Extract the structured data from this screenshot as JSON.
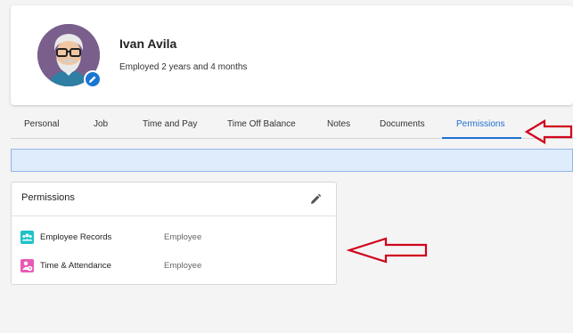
{
  "employee": {
    "name": "Ivan Avila",
    "tenure": "Employed 2 years and 4 months"
  },
  "tabs": [
    {
      "label": "Personal"
    },
    {
      "label": "Job"
    },
    {
      "label": "Time and Pay"
    },
    {
      "label": "Time Off Balance"
    },
    {
      "label": "Notes"
    },
    {
      "label": "Documents"
    },
    {
      "label": "Permissions",
      "active": true
    }
  ],
  "permissions": {
    "title": "Permissions",
    "rows": [
      {
        "label": "Employee Records",
        "value": "Employee",
        "icon": "people-icon",
        "color": "#1ec2c8"
      },
      {
        "label": "Time & Attendance",
        "value": "Employee",
        "icon": "person-clock-icon",
        "color": "#e85ab5"
      }
    ]
  },
  "colors": {
    "accent": "#1f6fd1",
    "arrow": "#d0021b"
  }
}
